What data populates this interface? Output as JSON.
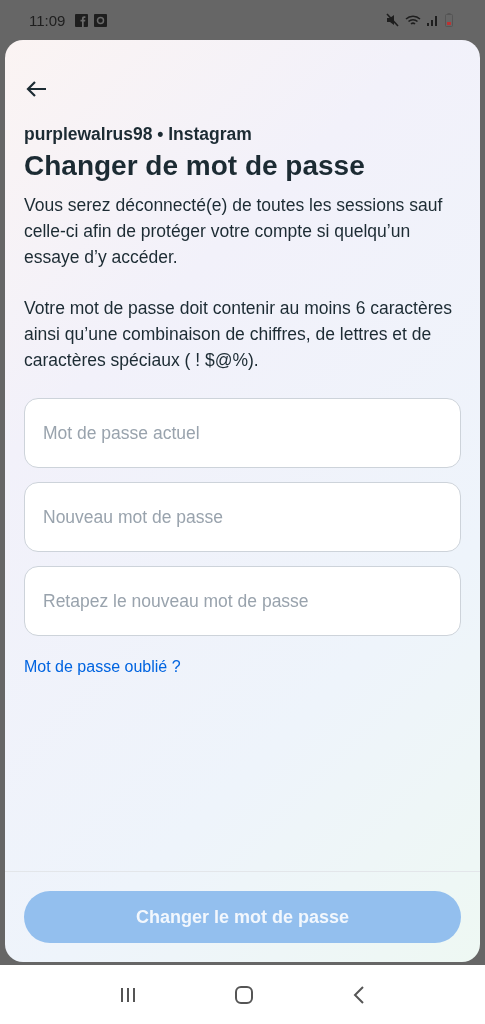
{
  "status_bar": {
    "time": "11:09"
  },
  "header": {
    "account": "purplewalrus98 • Instagram",
    "title": "Changer de mot de passe"
  },
  "paragraphs": [
    "Vous serez déconnecté(e) de toutes les sessions sauf celle-ci afin de protéger votre compte si quelqu’un essaye d’y accéder.",
    "Votre mot de passe doit contenir au moins 6 caractères ainsi qu’une combinaison de chiffres, de lettres et de caractères spéciaux ( ! $@%)."
  ],
  "fields": [
    {
      "placeholder": "Mot de passe actuel"
    },
    {
      "placeholder": "Nouveau mot de passe"
    },
    {
      "placeholder": "Retapez le nouveau mot de passe"
    }
  ],
  "forgot_link": "Mot de passe oublié ?",
  "submit": {
    "label": "Changer le mot de passe",
    "disabled": true
  }
}
